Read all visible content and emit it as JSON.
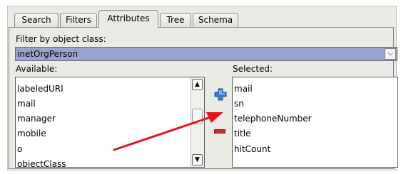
{
  "tabs": [
    {
      "label": "Search"
    },
    {
      "label": "Filters"
    },
    {
      "label": "Attributes"
    },
    {
      "label": "Tree"
    },
    {
      "label": "Schema"
    }
  ],
  "active_tab": "Attributes",
  "filter": {
    "label": "Filter by object class:",
    "value": "inetOrgPerson"
  },
  "available": {
    "label": "Available:",
    "items": [
      "labeledURI",
      "mail",
      "manager",
      "mobile",
      "o",
      "objectClass"
    ]
  },
  "selected": {
    "label": "Selected:",
    "items": [
      "mail",
      "sn",
      "telephoneNumber",
      "title",
      "hitCount"
    ]
  },
  "icons": {
    "add": "plus-icon",
    "remove": "minus-icon",
    "dropdown": "chevron-down-icon",
    "scroll_up": "chevron-up-icon",
    "scroll_down": "chevron-down-icon"
  },
  "colors": {
    "panel_bg": "#ebebe6",
    "combo_selected": "#98a4cc",
    "add_icon": "#3b7bd6",
    "remove_icon": "#d42a2a",
    "annotation_arrow": "#e8141c"
  }
}
